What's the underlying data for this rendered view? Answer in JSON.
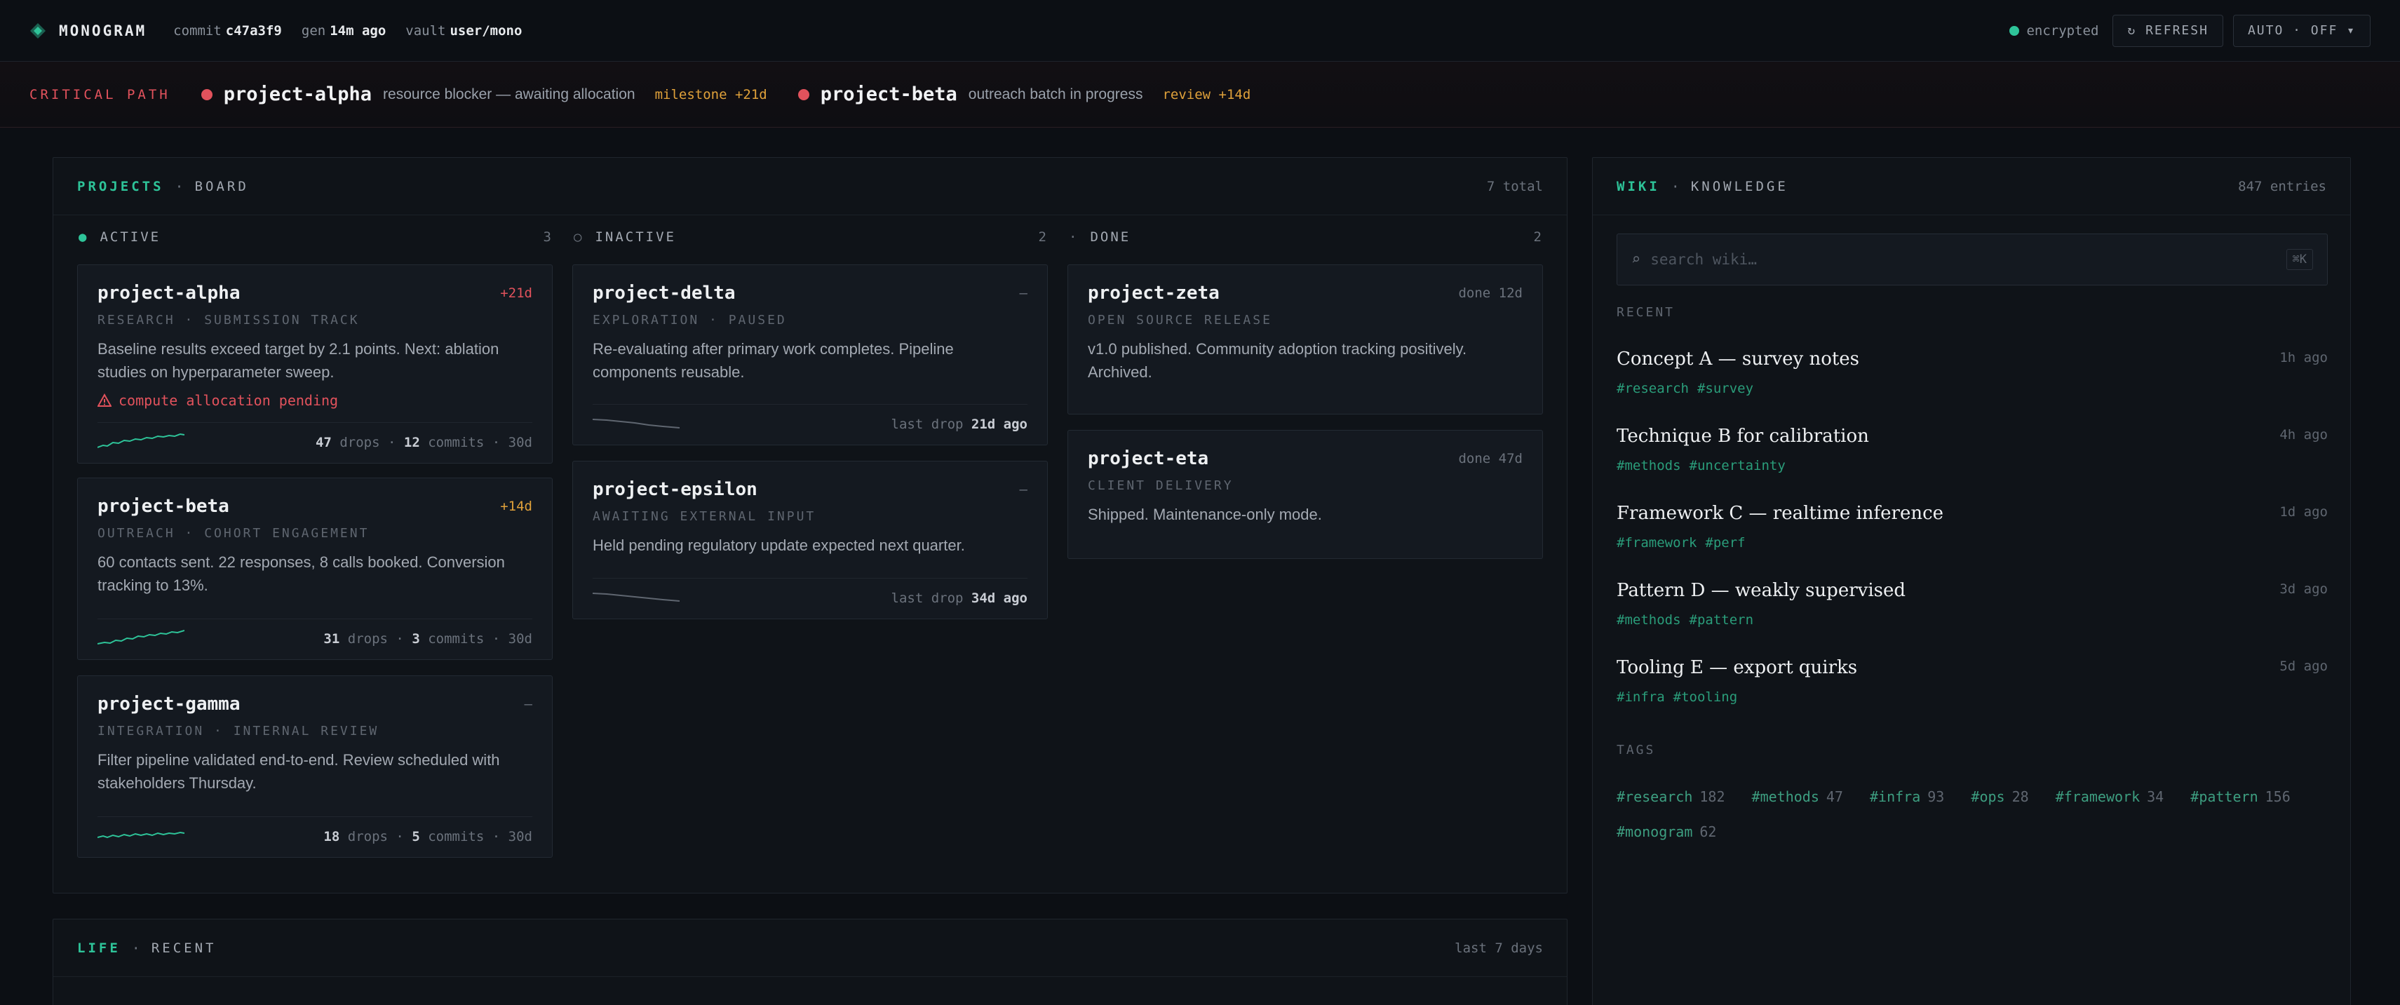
{
  "topbar": {
    "brand": "MONOGRAM",
    "commit_label": "commit",
    "commit_value": "c47a3f9",
    "gen_label": "gen",
    "gen_value": "14m ago",
    "vault_label": "vault",
    "vault_value": "user/mono",
    "status": "encrypted",
    "refresh_label": "↻ REFRESH",
    "auto_label": "AUTO · OFF ▾",
    "accent": "#2ec499"
  },
  "critical": {
    "label": "CRITICAL PATH",
    "items": [
      {
        "name": "project-alpha",
        "desc": "resource blocker — awaiting allocation",
        "tag": "milestone +21d"
      },
      {
        "name": "project-beta",
        "desc": "outreach batch in progress",
        "tag": "review +14d"
      }
    ]
  },
  "board": {
    "accent": "PROJECTS",
    "sep": "·",
    "title": "BOARD",
    "total": "7 total",
    "columns": [
      {
        "icon": "●",
        "label": "ACTIVE",
        "count": "3"
      },
      {
        "icon": "○",
        "label": "INACTIVE",
        "count": "2"
      },
      {
        "icon": "·",
        "label": "DONE",
        "count": "2"
      }
    ],
    "cards": {
      "alpha": {
        "name": "project-alpha",
        "badge": "+21d",
        "sub": "RESEARCH · SUBMISSION TRACK",
        "desc": "Baseline results exceed target by 2.1 points. Next: ablation studies on hyperparameter sweep.",
        "warn": "compute allocation pending",
        "drops": "47",
        "drops_label": "drops",
        "commits": "12",
        "commits_label": "commits",
        "period": "30d",
        "sep": "·"
      },
      "beta": {
        "name": "project-beta",
        "badge": "+14d",
        "sub": "OUTREACH · COHORT ENGAGEMENT",
        "desc": "60 contacts sent. 22 responses, 8 calls booked. Conversion tracking to 13%.",
        "drops": "31",
        "drops_label": "drops",
        "commits": "3",
        "commits_label": "commits",
        "period": "30d",
        "sep": "·"
      },
      "gamma": {
        "name": "project-gamma",
        "badge": "–",
        "sub": "INTEGRATION · INTERNAL REVIEW",
        "desc": "Filter pipeline validated end-to-end. Review scheduled with stakeholders Thursday.",
        "drops": "18",
        "drops_label": "drops",
        "commits": "5",
        "commits_label": "commits",
        "period": "30d",
        "sep": "·"
      },
      "delta": {
        "name": "project-delta",
        "badge": "–",
        "sub": "EXPLORATION · PAUSED",
        "desc": "Re-evaluating after primary work completes. Pipeline components reusable.",
        "last_label": "last drop",
        "last_value": "21d ago"
      },
      "epsilon": {
        "name": "project-epsilon",
        "badge": "–",
        "sub": "AWAITING EXTERNAL INPUT",
        "desc": "Held pending regulatory update expected next quarter.",
        "last_label": "last drop",
        "last_value": "34d ago"
      },
      "zeta": {
        "name": "project-zeta",
        "badge": "done 12d",
        "sub": "OPEN SOURCE RELEASE",
        "desc": "v1.0 published. Community adoption tracking positively. Archived."
      },
      "eta": {
        "name": "project-eta",
        "badge": "done 47d",
        "sub": "CLIENT DELIVERY",
        "desc": "Shipped. Maintenance-only mode."
      }
    }
  },
  "life": {
    "accent": "LIFE",
    "sep": "·",
    "title": "RECENT",
    "range": "last 7 days"
  },
  "wiki": {
    "accent": "WIKI",
    "sep": "·",
    "title": "KNOWLEDGE",
    "count": "847 entries",
    "search_placeholder": "search wiki…",
    "search_icon": "⌕",
    "shortcut": "⌘K",
    "recent_label": "RECENT",
    "entries": [
      {
        "title": "Concept A — survey notes",
        "time": "1h ago",
        "tags": [
          "#research",
          "#survey"
        ]
      },
      {
        "title": "Technique B for calibration",
        "time": "4h ago",
        "tags": [
          "#methods",
          "#uncertainty"
        ]
      },
      {
        "title": "Framework C — realtime inference",
        "time": "1d ago",
        "tags": [
          "#framework",
          "#perf"
        ]
      },
      {
        "title": "Pattern D — weakly supervised",
        "time": "3d ago",
        "tags": [
          "#methods",
          "#pattern"
        ]
      },
      {
        "title": "Tooling E — export quirks",
        "time": "5d ago",
        "tags": [
          "#infra",
          "#tooling"
        ]
      }
    ],
    "tags_label": "TAGS",
    "tags": [
      {
        "name": "#research",
        "count": "182"
      },
      {
        "name": "#methods",
        "count": "47"
      },
      {
        "name": "#infra",
        "count": "93"
      },
      {
        "name": "#ops",
        "count": "28"
      },
      {
        "name": "#framework",
        "count": "34"
      },
      {
        "name": "#pattern",
        "count": "156"
      },
      {
        "name": "#monogram",
        "count": "62"
      }
    ]
  }
}
